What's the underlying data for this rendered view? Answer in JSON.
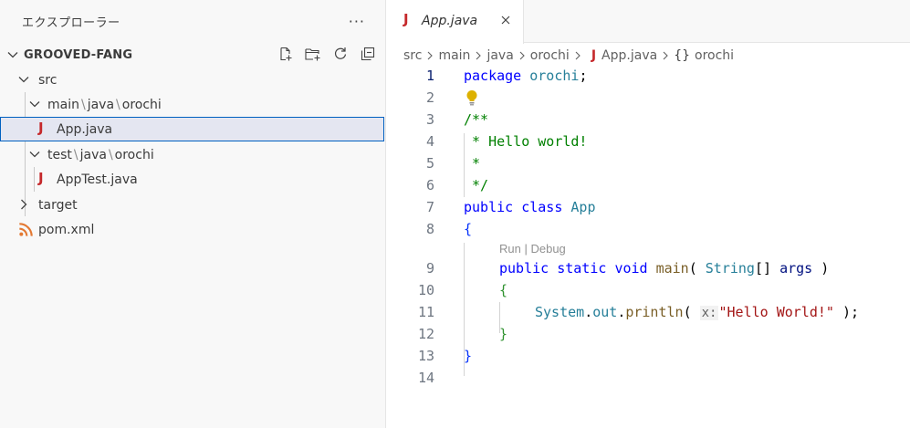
{
  "explorer": {
    "title": "エクスプローラー",
    "more_label": "···",
    "project_name": "GROOVED-FANG",
    "actions": [
      "new-file-icon",
      "new-folder-icon",
      "refresh-icon",
      "collapse-all-icon"
    ],
    "tree": {
      "src": "src",
      "main_path": [
        "main",
        "java",
        "orochi"
      ],
      "app_file": "App.java",
      "test_path": [
        "test",
        "java",
        "orochi"
      ],
      "apptest_file": "AppTest.java",
      "target": "target",
      "pom": "pom.xml"
    },
    "path_separator": "\\"
  },
  "editor": {
    "tab": {
      "icon": "J",
      "label": "App.java"
    },
    "breadcrumb": {
      "items": [
        "src",
        "main",
        "java",
        "orochi"
      ],
      "file_icon": "J",
      "file": "App.java",
      "symbol_icon": "{}",
      "symbol": "orochi"
    },
    "line_numbers": [
      "1",
      "2",
      "3",
      "4",
      "5",
      "6",
      "7",
      "8",
      "9",
      "10",
      "11",
      "12",
      "13",
      "14"
    ],
    "code": {
      "l1_kw": "package",
      "l1_pkg": "orochi",
      "l1_semi": ";",
      "l3": "/**",
      "l4": " * Hello world!",
      "l5": " *",
      "l6": " */",
      "l7_kw1": "public",
      "l7_kw2": "class",
      "l7_type": "App",
      "l8": "{",
      "codelens_run": "Run",
      "codelens_sep": " | ",
      "codelens_debug": "Debug",
      "l9_kw1": "public",
      "l9_kw2": "static",
      "l9_kw3": "void",
      "l9_fn": "main",
      "l9_open": "(",
      "l9_type": "String",
      "l9_arr": "[]",
      "l9_param": "args",
      "l9_close": ")",
      "l10": "{",
      "l11_cls": "System",
      "l11_dot1": ".",
      "l11_out": "out",
      "l11_dot2": ".",
      "l11_fn": "println",
      "l11_open": "(",
      "l11_hint": "x:",
      "l11_str": "\"Hello World!\"",
      "l11_close": " );",
      "l12": "}",
      "l13": "}"
    }
  },
  "colors": {
    "accent": "#0060c0",
    "java_icon": "#c5282b",
    "keyword": "#0000ff",
    "comment": "#008000",
    "string": "#a31515",
    "lightbulb": "#ddb100",
    "xml_icon": "#e37933"
  }
}
